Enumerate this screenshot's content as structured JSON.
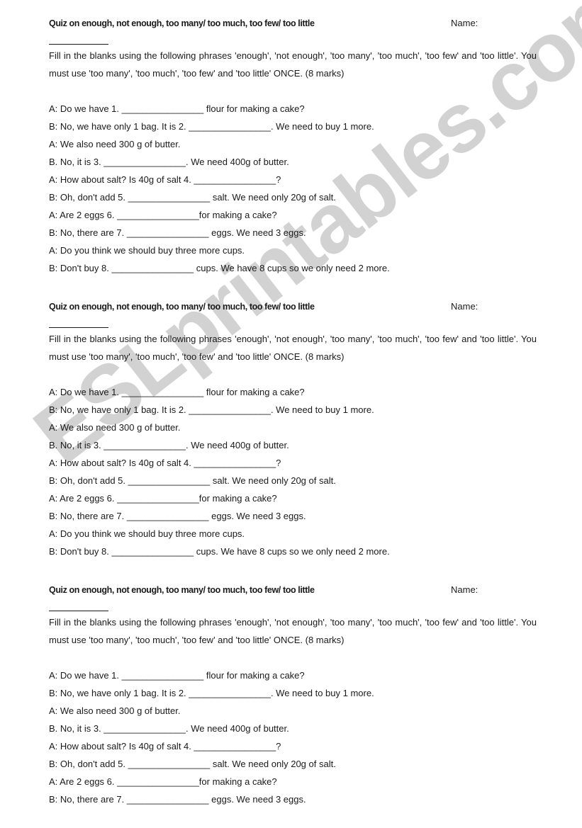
{
  "watermark": "ESLprintables.com",
  "quiz": {
    "title": "Quiz on enough, not enough, too many/ too much, too few/ too little",
    "name_label": "Name:",
    "instructions": "Fill in the blanks using the following phrases  'enough',  'not enough',  'too many',  'too much',  'too few'  and  'too little'. You must use  'too many',  'too much',  'too few'  and  'too little'  ONCE. (8 marks)",
    "lines": [
      "A: Do we have 1. ________________ flour for making a cake?",
      "B: No, we have only 1 bag. It is 2. ________________. We need to buy 1 more.",
      "A: We also need 300 g of butter.",
      "B. No, it is 3. ________________. We need 400g of butter.",
      "A: How about salt? Is 40g of salt 4. ________________?",
      "B: Oh, don't add 5. ________________ salt. We need only 20g of salt.",
      "A: Are 2 eggs 6. ________________for making a cake?",
      "B: No, there are 7. ________________ eggs. We need 3 eggs.",
      "A: Do you think we should buy three more cups.",
      "B: Don't buy 8. ________________ cups. We have 8 cups so we only need 2 more."
    ]
  },
  "copies": 3,
  "third_copy_visible_lines": 8
}
